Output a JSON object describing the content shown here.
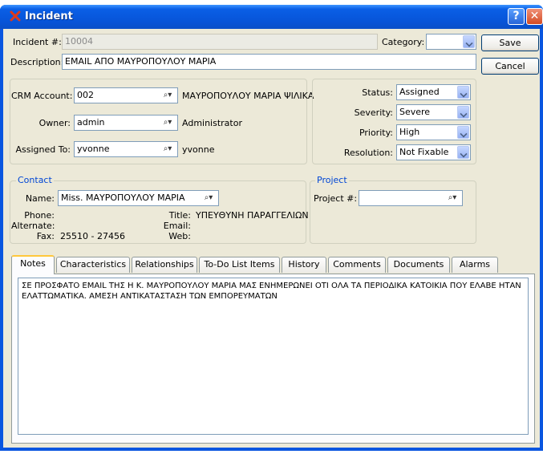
{
  "window": {
    "title": "Incident"
  },
  "header": {
    "incident_label": "Incident #:",
    "incident_value": "10004",
    "category_label": "Category:",
    "category_value": "",
    "description_label": "Description:",
    "description_value": "EMAIL ΑΠΟ ΜΑΥΡΟΠΟΥΛΟΥ ΜΑΡΙΑ"
  },
  "buttons": {
    "save": "Save",
    "cancel": "Cancel"
  },
  "account": {
    "crm_label": "CRM Account:",
    "crm_value": "002",
    "crm_name": "ΜΑΥΡΟΠΟΥΛΟΥ ΜΑΡΙΑ ΨΙΛΙΚΑ",
    "owner_label": "Owner:",
    "owner_value": "admin",
    "owner_name": "Administrator",
    "assigned_label": "Assigned To:",
    "assigned_value": "yvonne",
    "assigned_name": "yvonne"
  },
  "status": {
    "status_label": "Status:",
    "status_value": "Assigned",
    "severity_label": "Severity:",
    "severity_value": "Severe",
    "priority_label": "Priority:",
    "priority_value": "High",
    "resolution_label": "Resolution:",
    "resolution_value": "Not Fixable"
  },
  "contact": {
    "title": "Contact",
    "name_label": "Name:",
    "name_value": "Miss. ΜΑΥΡΟΠΟΥΛΟΥ ΜΑΡΙΑ",
    "phone_label": "Phone:",
    "alternate_label": "Alternate:",
    "fax_label": "Fax:",
    "fax_value": "25510 - 27456",
    "title_label": "Title:",
    "title_value": "ΥΠΕΥΘΥΝΗ ΠΑΡΑΓΓΕΛΙΩΝ",
    "email_label": "Email:",
    "web_label": "Web:"
  },
  "project": {
    "title": "Project",
    "project_label": "Project #:",
    "project_value": ""
  },
  "tabs": [
    {
      "label": "Notes"
    },
    {
      "label": "Characteristics"
    },
    {
      "label": "Relationships"
    },
    {
      "label": "To-Do List Items"
    },
    {
      "label": "History"
    },
    {
      "label": "Comments"
    },
    {
      "label": "Documents"
    },
    {
      "label": "Alarms"
    }
  ],
  "notes": {
    "text": "ΣΕ ΠΡΟΣΦΑΤΟ EMAIL ΤΗΣ Η Κ. ΜΑΥΡΟΠΟΥΛΟΥ ΜΑΡΙΑ ΜΑΣ ΕΝΗΜΕΡΩΝΕΙ ΟΤΙ ΟΛΑ ΤΑ ΠΕΡΙΟΔΙΚΑ ΚΑΤΟΙΚΙΑ ΠΟΥ ΕΛΑΒΕ ΗΤΑΝ ΕΛΑΤΤΩΜΑΤΙΚΑ. ΑΜΕΣΗ ΑΝΤΙΚΑΤΑΣΤΑΣΗ ΤΩΝ ΕΜΠΟΡΕΥΜΑΤΩΝ"
  },
  "icons": {
    "app": "app-logo-icon",
    "help": "help-icon",
    "close": "close-icon",
    "search": "search-icon",
    "dropdown": "chevron-down-icon"
  },
  "colors": {
    "titlebar": "#0a56e0",
    "client": "#ece9d8",
    "group_title": "#0046d5"
  }
}
